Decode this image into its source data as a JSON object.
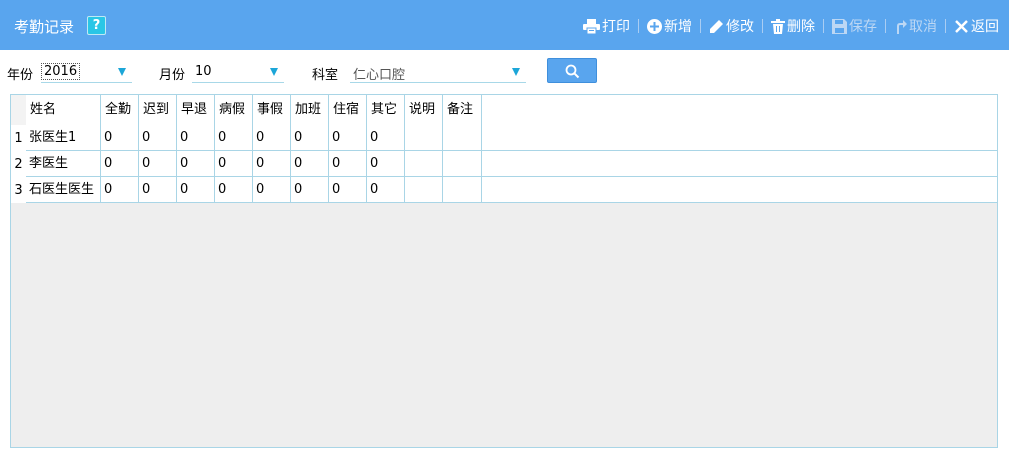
{
  "window": {
    "title": "考勤记录",
    "help_icon": "?"
  },
  "toolbar": {
    "print": "打印",
    "add": "新增",
    "edit": "修改",
    "delete": "删除",
    "save": "保存",
    "cancel": "取消",
    "back": "返回"
  },
  "filters": {
    "year_label": "年份",
    "year_value": "2016",
    "month_label": "月份",
    "month_value": "10",
    "dept_label": "科室",
    "dept_value": "仁心口腔"
  },
  "table": {
    "columns": [
      "姓名",
      "全勤",
      "迟到",
      "早退",
      "病假",
      "事假",
      "加班",
      "住宿",
      "其它",
      "说明",
      "备注"
    ],
    "rows": [
      {
        "no": "1",
        "cells": [
          "张医生1",
          "0",
          "0",
          "0",
          "0",
          "0",
          "0",
          "0",
          "0",
          "",
          ""
        ]
      },
      {
        "no": "2",
        "cells": [
          "李医生",
          "0",
          "0",
          "0",
          "0",
          "0",
          "0",
          "0",
          "0",
          "",
          ""
        ]
      },
      {
        "no": "3",
        "cells": [
          "石医生医生",
          "0",
          "0",
          "0",
          "0",
          "0",
          "0",
          "0",
          "0",
          "",
          ""
        ]
      }
    ]
  },
  "colors": {
    "titlebar": "#59a5ee",
    "accent": "#1ca6d8",
    "grid_border": "#a9d5e6"
  }
}
